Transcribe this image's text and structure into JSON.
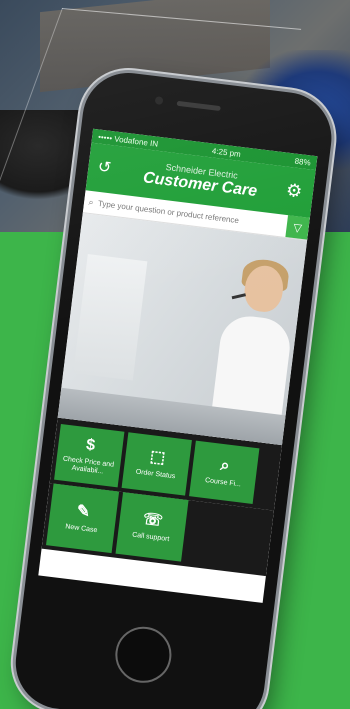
{
  "app": {
    "brand": "Schneider Electric",
    "title": "Customer Care"
  },
  "statusbar": {
    "carrier": "••••• Vodafone IN",
    "time": "4:25 pm",
    "battery": "88%"
  },
  "search": {
    "placeholder": "Type your question or product reference"
  },
  "tiles": [
    {
      "icon": "dollar-icon",
      "glyph": "$",
      "label": "Check Price and Availabil..."
    },
    {
      "icon": "box-icon",
      "glyph": "⬚",
      "label": "Order Status"
    },
    {
      "icon": "magnifier-icon",
      "glyph": "⌕",
      "label": "Course Fi..."
    },
    {
      "icon": "edit-icon",
      "glyph": "✎",
      "label": "New Case"
    },
    {
      "icon": "phone-icon",
      "glyph": "☏",
      "label": "Call support"
    }
  ],
  "colors": {
    "brand_green": "#3db54a",
    "header_green": "#1e9e36",
    "tile_green": "#2e9a3e"
  }
}
